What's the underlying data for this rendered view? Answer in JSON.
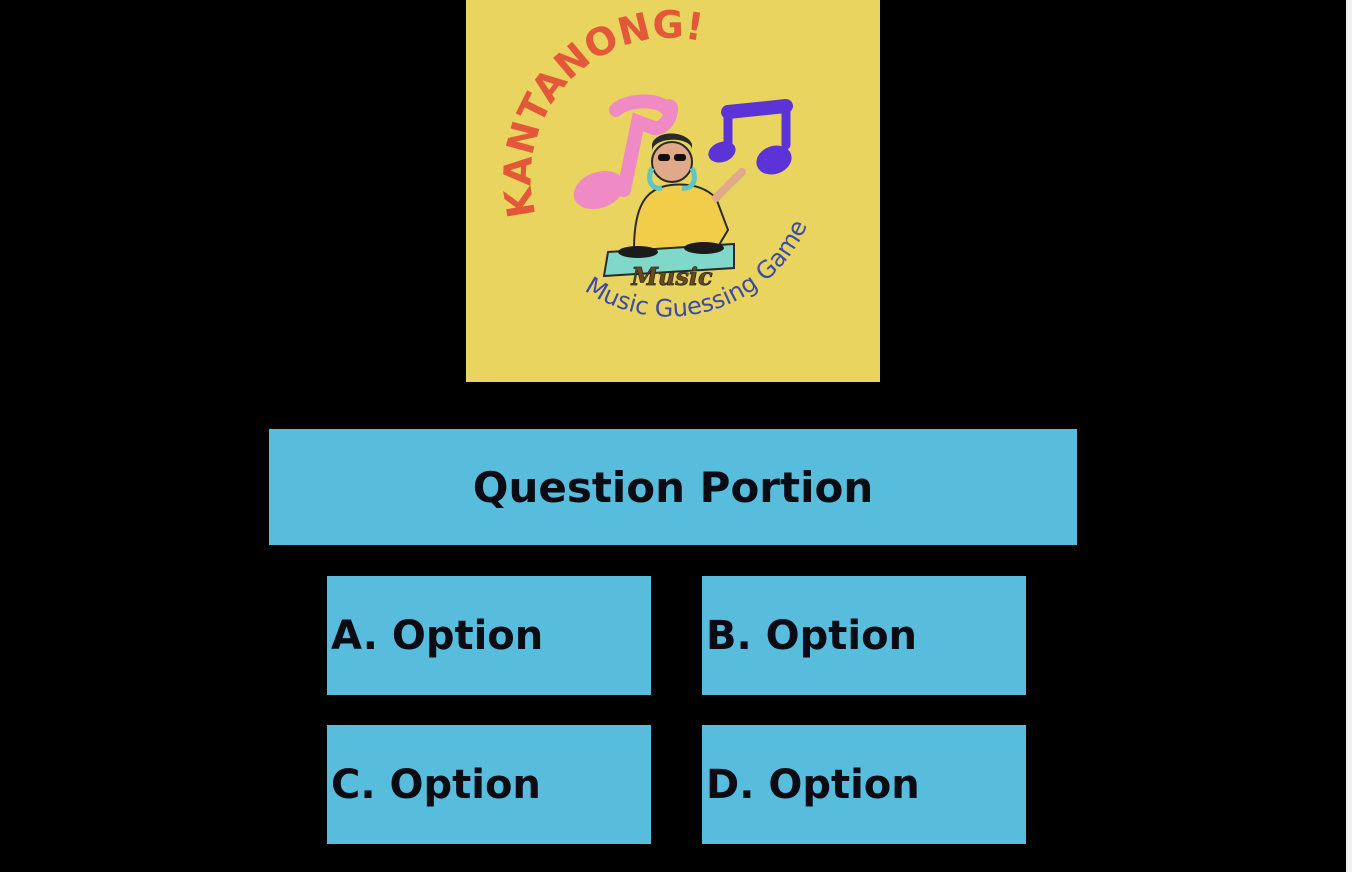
{
  "logo": {
    "title": "KANTANONG!",
    "badge": "Music",
    "tagline": "Music Guessing Game",
    "background_color": "#e8d45e"
  },
  "question": {
    "label": "Question Portion"
  },
  "options": [
    {
      "label": "A. Option"
    },
    {
      "label": "B. Option"
    },
    {
      "label": "C. Option"
    },
    {
      "label": "D. Option"
    }
  ],
  "colors": {
    "page_background": "#000000",
    "tile_background": "#58bcdc",
    "text": "#0b0b14",
    "logo_title": "#e4583a",
    "logo_tagline": "#3c4aa8"
  }
}
